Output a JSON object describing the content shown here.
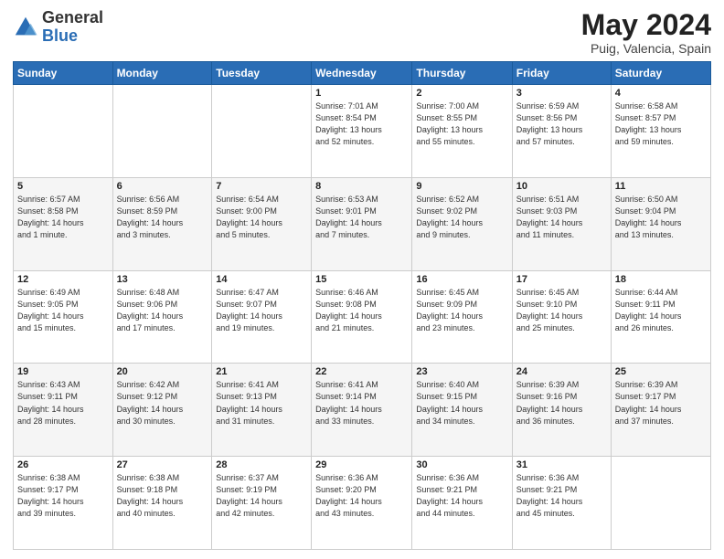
{
  "header": {
    "logo_general": "General",
    "logo_blue": "Blue",
    "month": "May 2024",
    "location": "Puig, Valencia, Spain"
  },
  "days_of_week": [
    "Sunday",
    "Monday",
    "Tuesday",
    "Wednesday",
    "Thursday",
    "Friday",
    "Saturday"
  ],
  "weeks": [
    [
      {
        "day": "",
        "info": ""
      },
      {
        "day": "",
        "info": ""
      },
      {
        "day": "",
        "info": ""
      },
      {
        "day": "1",
        "info": "Sunrise: 7:01 AM\nSunset: 8:54 PM\nDaylight: 13 hours\nand 52 minutes."
      },
      {
        "day": "2",
        "info": "Sunrise: 7:00 AM\nSunset: 8:55 PM\nDaylight: 13 hours\nand 55 minutes."
      },
      {
        "day": "3",
        "info": "Sunrise: 6:59 AM\nSunset: 8:56 PM\nDaylight: 13 hours\nand 57 minutes."
      },
      {
        "day": "4",
        "info": "Sunrise: 6:58 AM\nSunset: 8:57 PM\nDaylight: 13 hours\nand 59 minutes."
      }
    ],
    [
      {
        "day": "5",
        "info": "Sunrise: 6:57 AM\nSunset: 8:58 PM\nDaylight: 14 hours\nand 1 minute."
      },
      {
        "day": "6",
        "info": "Sunrise: 6:56 AM\nSunset: 8:59 PM\nDaylight: 14 hours\nand 3 minutes."
      },
      {
        "day": "7",
        "info": "Sunrise: 6:54 AM\nSunset: 9:00 PM\nDaylight: 14 hours\nand 5 minutes."
      },
      {
        "day": "8",
        "info": "Sunrise: 6:53 AM\nSunset: 9:01 PM\nDaylight: 14 hours\nand 7 minutes."
      },
      {
        "day": "9",
        "info": "Sunrise: 6:52 AM\nSunset: 9:02 PM\nDaylight: 14 hours\nand 9 minutes."
      },
      {
        "day": "10",
        "info": "Sunrise: 6:51 AM\nSunset: 9:03 PM\nDaylight: 14 hours\nand 11 minutes."
      },
      {
        "day": "11",
        "info": "Sunrise: 6:50 AM\nSunset: 9:04 PM\nDaylight: 14 hours\nand 13 minutes."
      }
    ],
    [
      {
        "day": "12",
        "info": "Sunrise: 6:49 AM\nSunset: 9:05 PM\nDaylight: 14 hours\nand 15 minutes."
      },
      {
        "day": "13",
        "info": "Sunrise: 6:48 AM\nSunset: 9:06 PM\nDaylight: 14 hours\nand 17 minutes."
      },
      {
        "day": "14",
        "info": "Sunrise: 6:47 AM\nSunset: 9:07 PM\nDaylight: 14 hours\nand 19 minutes."
      },
      {
        "day": "15",
        "info": "Sunrise: 6:46 AM\nSunset: 9:08 PM\nDaylight: 14 hours\nand 21 minutes."
      },
      {
        "day": "16",
        "info": "Sunrise: 6:45 AM\nSunset: 9:09 PM\nDaylight: 14 hours\nand 23 minutes."
      },
      {
        "day": "17",
        "info": "Sunrise: 6:45 AM\nSunset: 9:10 PM\nDaylight: 14 hours\nand 25 minutes."
      },
      {
        "day": "18",
        "info": "Sunrise: 6:44 AM\nSunset: 9:11 PM\nDaylight: 14 hours\nand 26 minutes."
      }
    ],
    [
      {
        "day": "19",
        "info": "Sunrise: 6:43 AM\nSunset: 9:11 PM\nDaylight: 14 hours\nand 28 minutes."
      },
      {
        "day": "20",
        "info": "Sunrise: 6:42 AM\nSunset: 9:12 PM\nDaylight: 14 hours\nand 30 minutes."
      },
      {
        "day": "21",
        "info": "Sunrise: 6:41 AM\nSunset: 9:13 PM\nDaylight: 14 hours\nand 31 minutes."
      },
      {
        "day": "22",
        "info": "Sunrise: 6:41 AM\nSunset: 9:14 PM\nDaylight: 14 hours\nand 33 minutes."
      },
      {
        "day": "23",
        "info": "Sunrise: 6:40 AM\nSunset: 9:15 PM\nDaylight: 14 hours\nand 34 minutes."
      },
      {
        "day": "24",
        "info": "Sunrise: 6:39 AM\nSunset: 9:16 PM\nDaylight: 14 hours\nand 36 minutes."
      },
      {
        "day": "25",
        "info": "Sunrise: 6:39 AM\nSunset: 9:17 PM\nDaylight: 14 hours\nand 37 minutes."
      }
    ],
    [
      {
        "day": "26",
        "info": "Sunrise: 6:38 AM\nSunset: 9:17 PM\nDaylight: 14 hours\nand 39 minutes."
      },
      {
        "day": "27",
        "info": "Sunrise: 6:38 AM\nSunset: 9:18 PM\nDaylight: 14 hours\nand 40 minutes."
      },
      {
        "day": "28",
        "info": "Sunrise: 6:37 AM\nSunset: 9:19 PM\nDaylight: 14 hours\nand 42 minutes."
      },
      {
        "day": "29",
        "info": "Sunrise: 6:36 AM\nSunset: 9:20 PM\nDaylight: 14 hours\nand 43 minutes."
      },
      {
        "day": "30",
        "info": "Sunrise: 6:36 AM\nSunset: 9:21 PM\nDaylight: 14 hours\nand 44 minutes."
      },
      {
        "day": "31",
        "info": "Sunrise: 6:36 AM\nSunset: 9:21 PM\nDaylight: 14 hours\nand 45 minutes."
      },
      {
        "day": "",
        "info": ""
      }
    ]
  ]
}
